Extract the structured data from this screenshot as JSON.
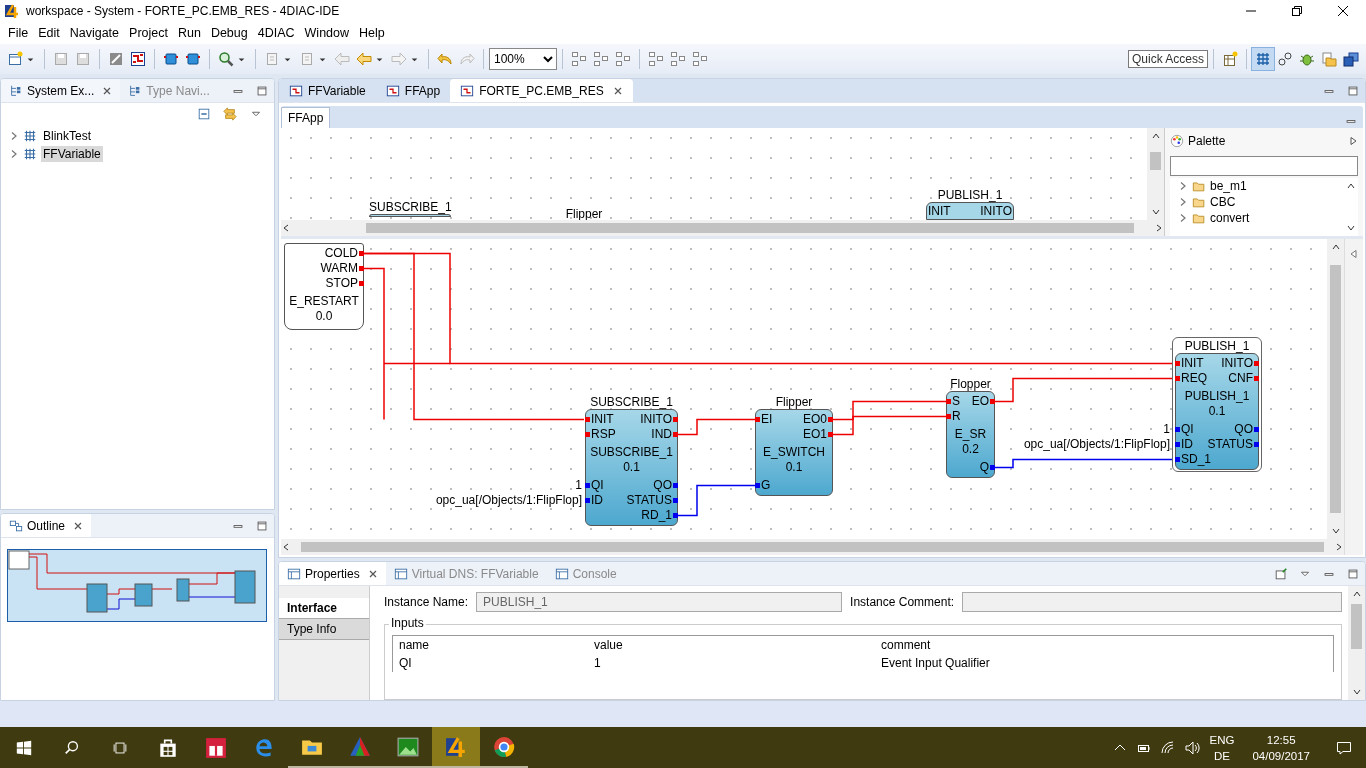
{
  "window": {
    "title": "workspace - System - FORTE_PC.EMB_RES - 4DIAC-IDE"
  },
  "menu": [
    "File",
    "Edit",
    "Navigate",
    "Project",
    "Run",
    "Debug",
    "4DIAC",
    "Window",
    "Help"
  ],
  "toolbar": {
    "zoom": "100%",
    "quick_access": "Quick Access"
  },
  "explorer": {
    "tabs": [
      {
        "label": "System Ex...",
        "selected": true
      },
      {
        "label": "Type Navi...",
        "selected": false
      }
    ],
    "tree": [
      {
        "label": "BlinkTest",
        "selected": false
      },
      {
        "label": "FFVariable",
        "selected": true
      }
    ]
  },
  "outline": {
    "title": "Outline"
  },
  "editor": {
    "tabs": [
      {
        "label": "FFVariable",
        "selected": false
      },
      {
        "label": "FFApp",
        "selected": false
      },
      {
        "label": "FORTE_PC.EMB_RES",
        "selected": true
      }
    ],
    "subtab": "FFApp",
    "preview_blocks": [
      {
        "name": "SUBSCRIBE_1"
      },
      {
        "name": "Flipper"
      },
      {
        "name": "PUBLISH_1",
        "event_inputs": [
          "INIT"
        ],
        "event_outputs": [
          "INITO"
        ]
      }
    ],
    "palette": {
      "title": "Palette",
      "items": [
        "be_m1",
        "CBC",
        "convert"
      ]
    },
    "blocks": [
      {
        "kind": "restart",
        "selected": false,
        "event_outputs": [
          "COLD",
          "WARM",
          "STOP"
        ],
        "type": "E_RESTART",
        "version": "0.0"
      },
      {
        "kind": "fb",
        "name": "SUBSCRIBE_1",
        "selected": false,
        "event_inputs": [
          "INIT",
          "RSP"
        ],
        "event_outputs": [
          "INITO",
          "IND"
        ],
        "type": "SUBSCRIBE_1",
        "version": "0.1",
        "data_inputs": [
          {
            "name": "QI",
            "value": "1"
          },
          {
            "name": "ID",
            "value": "opc_ua[/Objects/1:FlipFlop]"
          }
        ],
        "data_outputs": [
          "QO",
          "STATUS",
          "RD_1"
        ]
      },
      {
        "kind": "fb",
        "name": "Flipper",
        "selected": false,
        "event_inputs": [
          "EI"
        ],
        "event_outputs": [
          "EO0",
          "EO1"
        ],
        "type": "E_SWITCH",
        "version": "0.1",
        "data_inputs": [
          {
            "name": "G"
          }
        ]
      },
      {
        "kind": "fb",
        "name": "Flopper",
        "selected": false,
        "event_inputs": [
          "S",
          "R"
        ],
        "event_outputs": [
          "EO"
        ],
        "type": "E_SR",
        "version": "0.2",
        "data_outputs": [
          "Q"
        ]
      },
      {
        "kind": "fb",
        "name": "PUBLISH_1",
        "selected": true,
        "event_inputs": [
          "INIT",
          "REQ"
        ],
        "event_outputs": [
          "INITO",
          "CNF"
        ],
        "type": "PUBLISH_1",
        "version": "0.1",
        "data_inputs": [
          {
            "name": "QI",
            "value": "1"
          },
          {
            "name": "ID",
            "value": "opc_ua[/Objects/1:FlipFlop]"
          },
          {
            "name": "SD_1"
          }
        ],
        "data_outputs": [
          "QO",
          "STATUS"
        ]
      }
    ]
  },
  "properties": {
    "tabs": [
      {
        "label": "Properties",
        "selected": true
      },
      {
        "label": "Virtual DNS: FFVariable",
        "selected": false
      },
      {
        "label": "Console",
        "selected": false
      }
    ],
    "side_tabs": [
      {
        "label": "Interface",
        "selected": true
      },
      {
        "label": "Type Info",
        "selected": false
      }
    ],
    "instance_name_label": "Instance Name:",
    "instance_name": "PUBLISH_1",
    "instance_comment_label": "Instance Comment:",
    "group": "Inputs",
    "columns": [
      "name",
      "value",
      "comment"
    ],
    "rows": [
      [
        "QI",
        "1",
        "Event Input Qualifier"
      ]
    ]
  },
  "taskbar": {
    "apps": [
      {
        "kind": "store",
        "running": false,
        "selected": false
      },
      {
        "kind": "gift",
        "running": false,
        "selected": false
      },
      {
        "kind": "edge",
        "running": false,
        "selected": false
      },
      {
        "kind": "folder",
        "running": true,
        "selected": false
      },
      {
        "kind": "triangle",
        "running": true,
        "selected": false
      },
      {
        "kind": "image",
        "running": true,
        "selected": false
      },
      {
        "kind": "fourdiac",
        "running": true,
        "selected": true
      },
      {
        "kind": "chrome",
        "running": true,
        "selected": false
      }
    ],
    "tray": {
      "language": "ENG",
      "layout": "DE",
      "time": "12:55",
      "date": "04/09/2017"
    }
  }
}
